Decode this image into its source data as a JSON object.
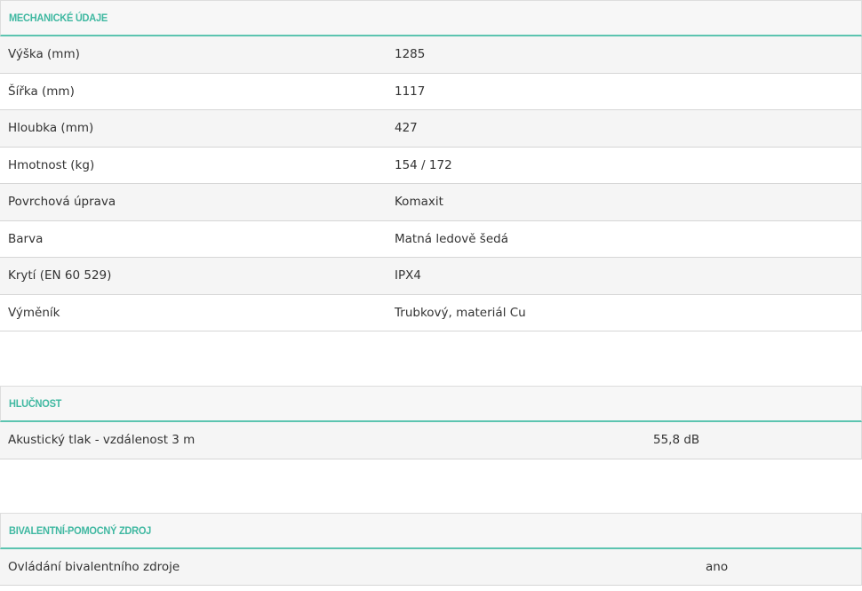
{
  "sections": [
    {
      "title": "MECHANICKÉ ÚDAJE",
      "rows": [
        {
          "label": "Výška (mm)",
          "value": "1285"
        },
        {
          "label": "Šířka (mm)",
          "value": "1117"
        },
        {
          "label": "Hloubka (mm)",
          "value": "427"
        },
        {
          "label": "Hmotnost (kg)",
          "value": "154 / 172"
        },
        {
          "label": "Povrchová úprava",
          "value": "Komaxit"
        },
        {
          "label": "Barva",
          "value": "Matná ledově šedá"
        },
        {
          "label": "Krytí (EN 60 529)",
          "value": "IPX4"
        },
        {
          "label": "Výměník",
          "value": "Trubkový, materiál Cu"
        }
      ]
    },
    {
      "title": "HLUČNOST",
      "rows": [
        {
          "label": "Akustický tlak - vzdálenost 3 m",
          "value": "55,8 dB"
        }
      ]
    },
    {
      "title": "BIVALENTNÍ-POMOCNÝ ZDROJ",
      "rows": [
        {
          "label": "Ovládání bivalentního zdroje",
          "value": "ano"
        }
      ]
    }
  ],
  "colors": {
    "accent": "#3fb8a1",
    "row_alt": "#f5f5f5",
    "header_bg": "#f7f7f7"
  }
}
